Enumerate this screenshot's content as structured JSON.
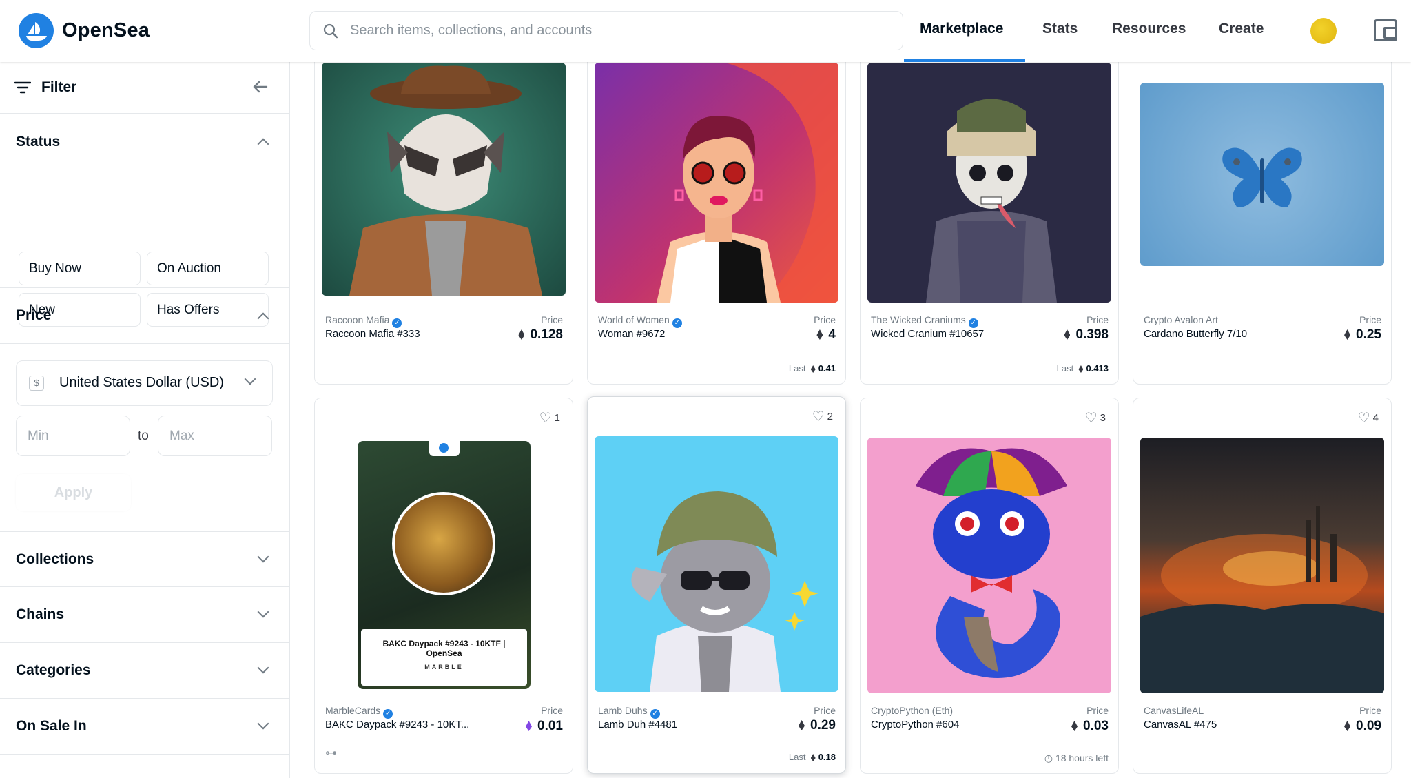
{
  "header": {
    "brand": "OpenSea",
    "search_placeholder": "Search items, collections, and accounts",
    "nav": [
      "Marketplace",
      "Stats",
      "Resources",
      "Create"
    ]
  },
  "sidebar": {
    "filter_label": "Filter",
    "status": {
      "title": "Status",
      "options": [
        "Buy Now",
        "On Auction",
        "New",
        "Has Offers"
      ]
    },
    "price": {
      "title": "Price",
      "currency_symbol": "$",
      "currency": "United States Dollar (USD)",
      "min_placeholder": "Min",
      "to_label": "to",
      "max_placeholder": "Max",
      "apply_label": "Apply"
    },
    "sections": [
      "Collections",
      "Chains",
      "Categories",
      "On Sale In"
    ]
  },
  "cards": [
    {
      "collection": "Raccoon Mafia",
      "verified": true,
      "name": "Raccoon Mafia #333",
      "price_label": "Price",
      "price": "0.128"
    },
    {
      "collection": "World of Women",
      "verified": true,
      "name": "Woman #9672",
      "price_label": "Price",
      "price": "4",
      "last_label": "Last",
      "last": "0.41"
    },
    {
      "collection": "The Wicked Craniums",
      "verified": true,
      "name": "Wicked Cranium #10657",
      "price_label": "Price",
      "price": "0.398",
      "last_label": "Last",
      "last": "0.413"
    },
    {
      "collection": "Crypto Avalon Art",
      "verified": false,
      "name": "Cardano Butterfly 7/10",
      "price_label": "Price",
      "price": "0.25"
    },
    {
      "collection": "MarbleCards",
      "verified": true,
      "name": "BAKC Daypack #9243 - 10KT...",
      "price_label": "Price",
      "price": "0.01",
      "favorites": "1",
      "marble_title": "BAKC Daypack #9243 - 10KTF | OpenSea",
      "marble_brand": "MARBLE"
    },
    {
      "collection": "Lamb Duhs",
      "verified": true,
      "name": "Lamb Duh #4481",
      "price_label": "Price",
      "price": "0.29",
      "favorites": "2",
      "last_label": "Last",
      "last": "0.18"
    },
    {
      "collection": "CryptoPython (Eth)",
      "verified": false,
      "name": "CryptoPython #604",
      "price_label": "Price",
      "price": "0.03",
      "favorites": "3",
      "time_left": "18 hours left"
    },
    {
      "collection": "CanvasLifeAL",
      "verified": false,
      "name": "CanvasAL #475",
      "price_label": "Price",
      "price": "0.09",
      "favorites": "4"
    }
  ],
  "colors": {
    "accent": "#2081e2",
    "text": "#04111d",
    "muted": "#707a83",
    "border": "#e5e8eb",
    "polygon": "#8247e5"
  }
}
